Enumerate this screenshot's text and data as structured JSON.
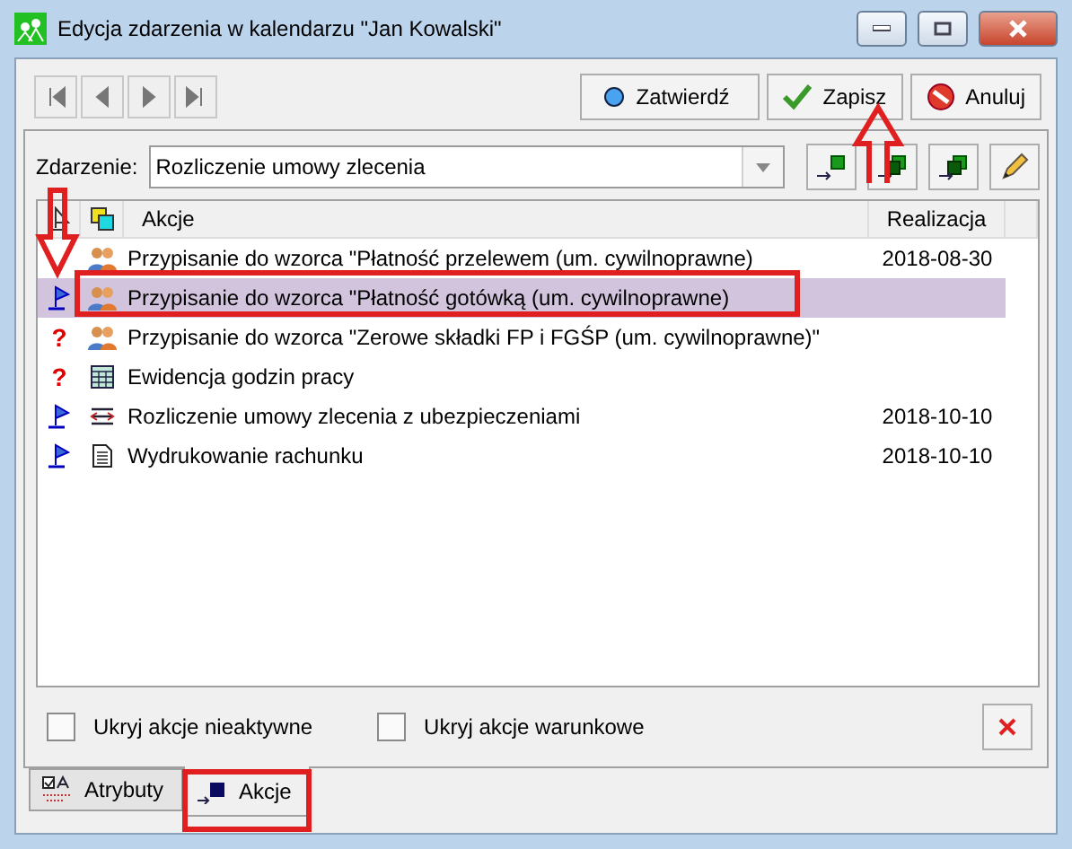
{
  "window": {
    "title": "Edycja zdarzenia w kalendarzu \"Jan Kowalski\""
  },
  "actions": [
    {
      "label": "Zatwierdź",
      "kind": "confirm"
    },
    {
      "label": "Zapisz",
      "kind": "save"
    },
    {
      "label": "Anuluj",
      "kind": "cancel"
    }
  ],
  "event": {
    "label": "Zdarzenie:",
    "value": "Rozliczenie umowy zlecenia"
  },
  "table": {
    "columns": [
      "Akcje",
      "Realizacja"
    ],
    "rows": [
      {
        "flag": false,
        "kind": "people",
        "name": "Przypisanie do wzorca \"Płatność przelewem (um. cywilnoprawne)",
        "date": "2018-08-30",
        "selected": false
      },
      {
        "flag": true,
        "kind": "people",
        "name": "Przypisanie do wzorca \"Płatność gotówką (um. cywilnoprawne)",
        "selected": true
      },
      {
        "status": "?",
        "kind": "people",
        "name": "Przypisanie do wzorca \"Zerowe składki FP i FGŚP (um. cywilnoprawne)\"",
        "selected": false
      },
      {
        "status": "?",
        "kind": "calendar",
        "name": "Ewidencja godzin pracy",
        "selected": false
      },
      {
        "flag": true,
        "kind": "transfer",
        "name": "Rozliczenie umowy zlecenia z ubezpieczeniami",
        "date": "2018-10-10",
        "selected": false
      },
      {
        "flag": true,
        "kind": "document",
        "name": "Wydrukowanie rachunku",
        "date": "2018-10-10",
        "selected": false
      }
    ]
  },
  "filters": [
    {
      "label": "Ukryj akcje nieaktywne",
      "checked": false
    },
    {
      "label": "Ukryj akcje warunkowe",
      "checked": false
    }
  ],
  "tabs": [
    {
      "label": "Atrybuty",
      "kind": "attributes",
      "selected": false
    },
    {
      "label": "Akcje",
      "kind": "actions",
      "selected": true
    }
  ]
}
